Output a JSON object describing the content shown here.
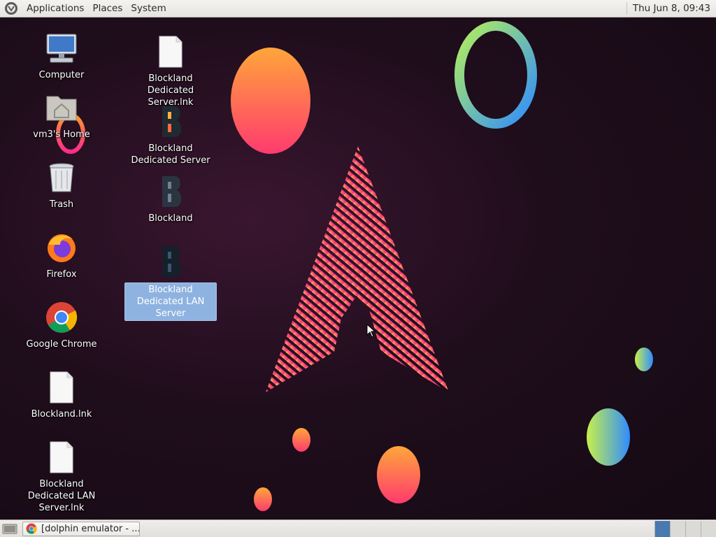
{
  "top_panel": {
    "menus": [
      "Applications",
      "Places",
      "System"
    ],
    "clock": "Thu Jun  8, 09:43"
  },
  "desktop_icons_left": [
    {
      "label": "Computer",
      "icon": "computer-icon"
    },
    {
      "label": "vm3's Home",
      "icon": "home-folder-icon"
    },
    {
      "label": "Trash",
      "icon": "trash-icon"
    },
    {
      "label": "Firefox",
      "icon": "firefox-icon"
    },
    {
      "label": "Google Chrome",
      "icon": "chrome-icon"
    },
    {
      "label": "Blockland.lnk",
      "icon": "file-icon"
    },
    {
      "label": "Blockland Dedicated LAN Server.lnk",
      "icon": "file-icon"
    }
  ],
  "desktop_icons_right": [
    {
      "label": "Blockland Dedicated Server.lnk",
      "icon": "file-icon",
      "selected": false
    },
    {
      "label": "Blockland Dedicated Server",
      "icon": "blockland-icon",
      "selected": false
    },
    {
      "label": "Blockland",
      "icon": "blockland-icon",
      "selected": false
    },
    {
      "label": "Blockland Dedicated LAN Server",
      "icon": "blockland-icon",
      "selected": true
    }
  ],
  "taskbar": {
    "task_label": "[dolphin emulator - ...",
    "workspace_count": 4,
    "active_workspace": 1
  },
  "colors": {
    "selection": "#8fb3e0",
    "panel": "#e9e7e3",
    "wallpaper_bg": "#1f0d1c"
  }
}
